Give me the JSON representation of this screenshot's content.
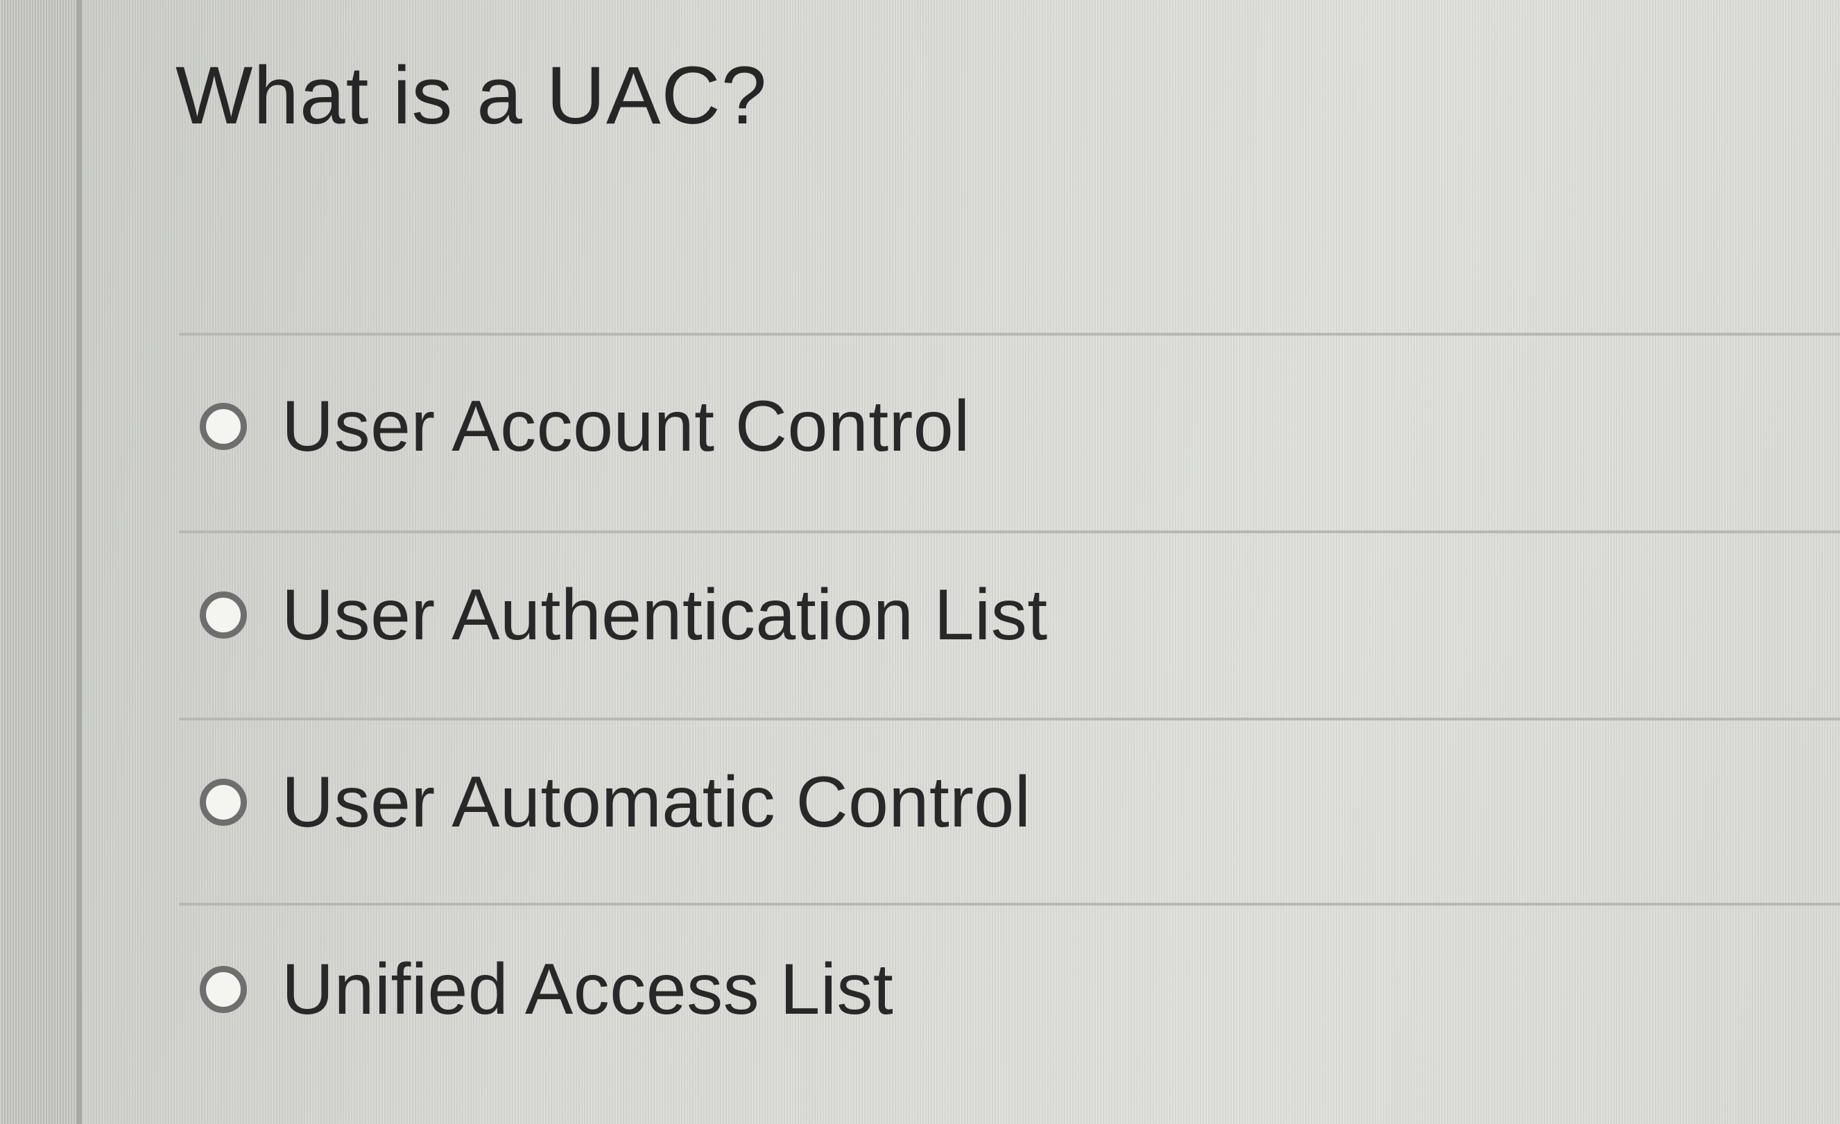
{
  "question": {
    "title": "What is a UAC?"
  },
  "options": [
    {
      "label": "User Account Control",
      "selected": false
    },
    {
      "label": "User Authentication List",
      "selected": false
    },
    {
      "label": "User Automatic Control",
      "selected": false
    },
    {
      "label": "Unified Access List",
      "selected": false
    }
  ],
  "icons": {
    "radio": "radio-button-icon"
  },
  "colors": {
    "background": "#d6d7d2",
    "text": "#262626",
    "radio_border": "#6e6e6e",
    "divider": "#b7b8b3"
  }
}
